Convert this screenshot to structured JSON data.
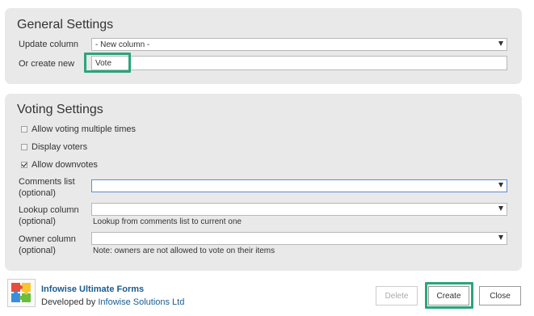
{
  "general": {
    "title": "General Settings",
    "update_column_label": "Update column",
    "update_column_value": "- New column -",
    "create_new_label": "Or create new",
    "create_new_value": "Vote"
  },
  "voting": {
    "title": "Voting Settings",
    "checkboxes": [
      {
        "label": "Allow voting multiple times",
        "checked": false
      },
      {
        "label": "Display voters",
        "checked": false
      },
      {
        "label": "Allow downvotes",
        "checked": true
      }
    ],
    "comments_label": "Comments list",
    "comments_sub": "(optional)",
    "comments_value": "",
    "lookup_label": "Lookup column",
    "lookup_sub": "(optional)",
    "lookup_value": "",
    "lookup_hint": "Lookup from comments list to current one",
    "owner_label": "Owner column",
    "owner_sub": "(optional)",
    "owner_value": "",
    "owner_hint": "Note: owners are not allowed to vote on their items"
  },
  "footer": {
    "product": "Infowise Ultimate Forms",
    "developed_by": "Developed by",
    "company": "Infowise Solutions Ltd",
    "logo_icon": "puzzle-icon"
  },
  "buttons": {
    "delete": "Delete",
    "create": "Create",
    "close": "Close"
  },
  "colors": {
    "highlight": "#2aa57b",
    "link": "#1a5c8f",
    "focus": "#5b8ed6"
  }
}
